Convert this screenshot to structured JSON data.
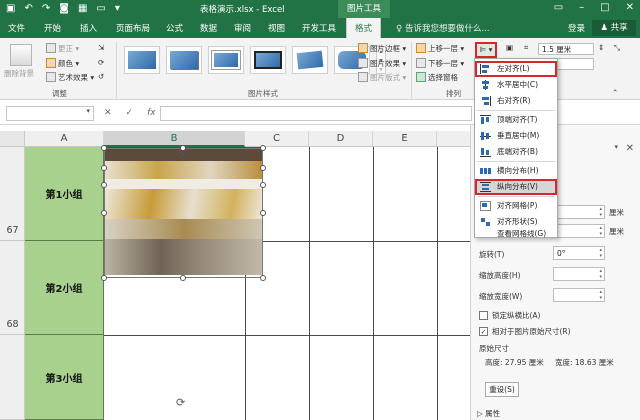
{
  "titlebar": {
    "document_title": "表格演示.xlsx - Excel",
    "context_tools": "图片工具"
  },
  "tabs": {
    "file": "文件",
    "home": "开始",
    "insert": "插入",
    "page_layout": "页面布局",
    "formulas": "公式",
    "data": "数据",
    "review": "审阅",
    "view": "视图",
    "developer": "开发工具",
    "format": "格式",
    "tell_me": "告诉我您想要做什么...",
    "login": "登录",
    "share": "共享"
  },
  "ribbon": {
    "remove_bg": "删除背景",
    "corrections": "更正",
    "color": "颜色",
    "artistic": "艺术效果",
    "adjust_group": "调整",
    "styles_group": "图片样式",
    "picture_border": "图片边框",
    "picture_effects": "图片效果",
    "picture_layout": "图片版式",
    "bring_forward": "上移一层",
    "send_backward": "下移一层",
    "selection_pane": "选择窗格",
    "arrange_group": "排列",
    "height_value": "1.5 厘米",
    "width_value": "厘米"
  },
  "formula_bar": {
    "namebox_value": "",
    "fx": "fx",
    "cancel": "✕",
    "enter": "✓"
  },
  "grid": {
    "columns": [
      "A",
      "B",
      "C",
      "D",
      "E"
    ],
    "row_numbers": [
      "67",
      "68"
    ],
    "groups": [
      "第1小组",
      "第2小组",
      "第3小组"
    ]
  },
  "align_menu": {
    "items": [
      {
        "label": "左对齐(L)"
      },
      {
        "label": "水平居中(C)"
      },
      {
        "label": "右对齐(R)"
      },
      {
        "label": "顶端对齐(T)"
      },
      {
        "label": "垂直居中(M)"
      },
      {
        "label": "底端对齐(B)"
      },
      {
        "label": "横向分布(H)"
      },
      {
        "label": "纵向分布(V)"
      },
      {
        "label": "对齐网格(P)"
      },
      {
        "label": "对齐形状(S)"
      },
      {
        "label": "查看网格线(G)"
      }
    ]
  },
  "pane": {
    "unit1": "厘米",
    "unit2": "厘米",
    "rotation_label": "旋转(T)",
    "rotation_value": "0°",
    "scale_height_label": "缩放高度(H)",
    "scale_width_label": "缩放宽度(W)",
    "lock_ratio_label": "锁定纵横比(A)",
    "relative_label": "相对于图片原始尺寸(R)",
    "original_size_label": "原始尺寸",
    "orig_height": "高度:  27.95 厘米",
    "orig_width": "宽度:  18.63 厘米",
    "reset_label": "重设(S)",
    "properties_label": "属性"
  },
  "colors": {
    "excel_green": "#217346",
    "group_cell_green": "#a9d18e",
    "highlight_red": "#d8262d"
  }
}
